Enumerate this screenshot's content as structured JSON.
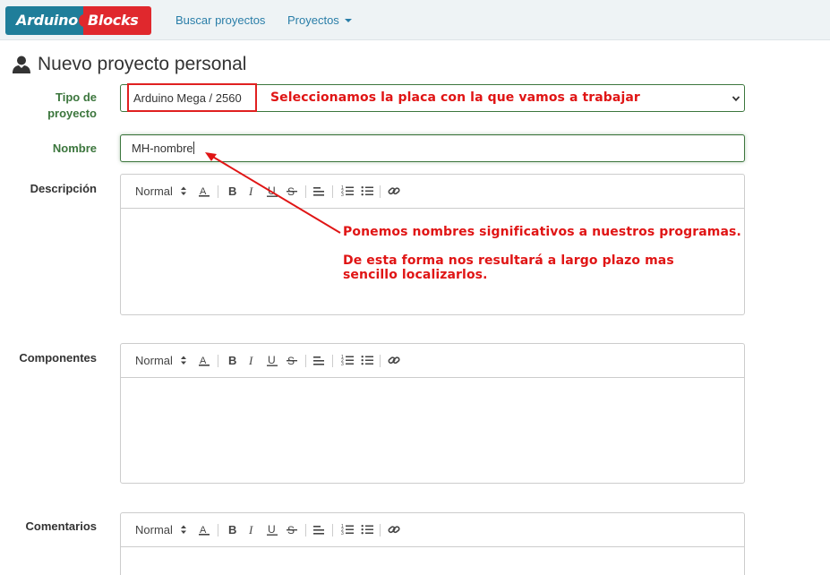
{
  "navbar": {
    "logo_left": "Arduino",
    "logo_right": "Blocks",
    "links": [
      {
        "label": "Buscar proyectos"
      },
      {
        "label": "Proyectos"
      }
    ]
  },
  "page": {
    "title": "Nuevo proyecto personal",
    "title_icon": "user-icon"
  },
  "form": {
    "board_label": "Tipo de proyecto",
    "board_value": "Arduino Mega / 2560",
    "name_label": "Nombre",
    "name_value": "MH-nombre",
    "description_label": "Descripción",
    "components_label": "Componentes",
    "comments_label": "Comentarios",
    "toolbar": {
      "format_label": "Normal",
      "buttons": [
        "font-color-icon",
        "bold-icon",
        "italic-icon",
        "underline-icon",
        "strike-icon",
        "align-icon",
        "ordered-list-icon",
        "bullet-list-icon",
        "link-icon"
      ]
    }
  },
  "annotations": {
    "board_note": "Seleccionamos la placa con la que vamos a trabajar",
    "name_note_1": "Ponemos nombres significativos a nuestros programas.",
    "name_note_2": "De esta forma nos resultará a largo plazo mas sencillo localizarlos.",
    "accent_color": "#e01515"
  },
  "colors": {
    "navbar_bg": "#eef3f5",
    "link": "#2a7ea8",
    "success": "#3c763d",
    "logo_blue": "#1f7e9a",
    "logo_red": "#e0282d"
  }
}
